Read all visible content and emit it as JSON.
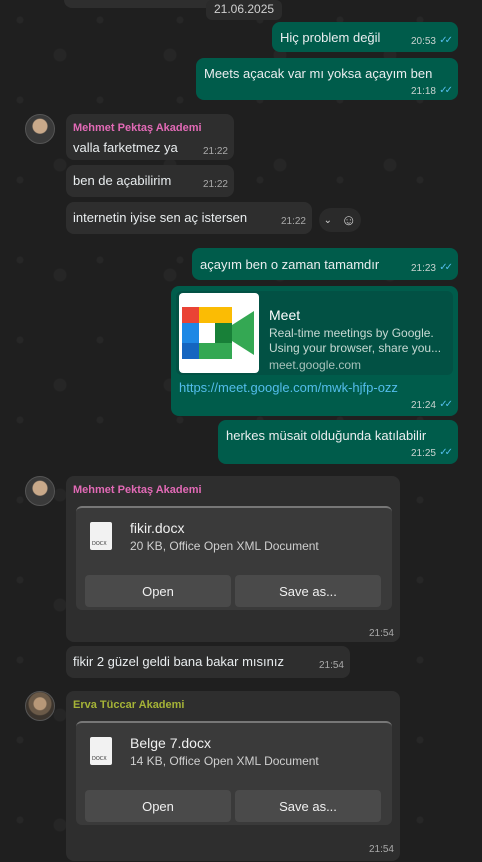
{
  "date_separator": "21.06.2025",
  "messages": [
    {
      "text": "Hiç problem değil",
      "time": "20:53"
    },
    {
      "text": "Meets açacak var mı yoksa açayım ben",
      "time": "21:18"
    },
    {
      "sender": "Mehmet Pektaş Akademi",
      "text": "valla farketmez ya",
      "time": "21:22"
    },
    {
      "text": "ben de açabilirim",
      "time": "21:22"
    },
    {
      "text": "internetin iyise sen aç istersen",
      "time": "21:22"
    },
    {
      "text": "açayım ben o zaman tamamdır",
      "time": "21:23"
    },
    {
      "link_title": "Meet",
      "link_desc": "Real-time meetings by Google. Using your browser, share you...",
      "link_domain": "meet.google.com",
      "text": "https://meet.google.com/mwk-hjfp-ozz",
      "time": "21:24"
    },
    {
      "text": "herkes müsait olduğunda katılabilir",
      "time": "21:25"
    },
    {
      "sender": "Mehmet Pektaş Akademi",
      "file_name": "fikir.docx",
      "file_meta": "20 KB, Office Open XML Document",
      "open_label": "Open",
      "save_label": "Save as...",
      "time": "21:54"
    },
    {
      "text": "fikir 2 güzel geldi bana bakar mısınız",
      "time": "21:54"
    },
    {
      "sender": "Erva Tüccar Akademi",
      "file_name": "Belge 7.docx",
      "file_meta": "14 KB, Office Open XML Document",
      "open_label": "Open",
      "save_label": "Save as...",
      "time": "21:54"
    }
  ],
  "colors": {
    "outgoing_bubble": "#005c4b",
    "incoming_bubble": "#2e2e2e",
    "sender_mehmet": "#e26ab6",
    "sender_erva": "#a5b337",
    "read_ticks": "#53bdeb"
  },
  "icons": {
    "read": "double-check-icon",
    "react": "emoji-icon",
    "menu": "chevron-down-icon",
    "document": "docx-file-icon",
    "meet": "google-meet-logo"
  }
}
